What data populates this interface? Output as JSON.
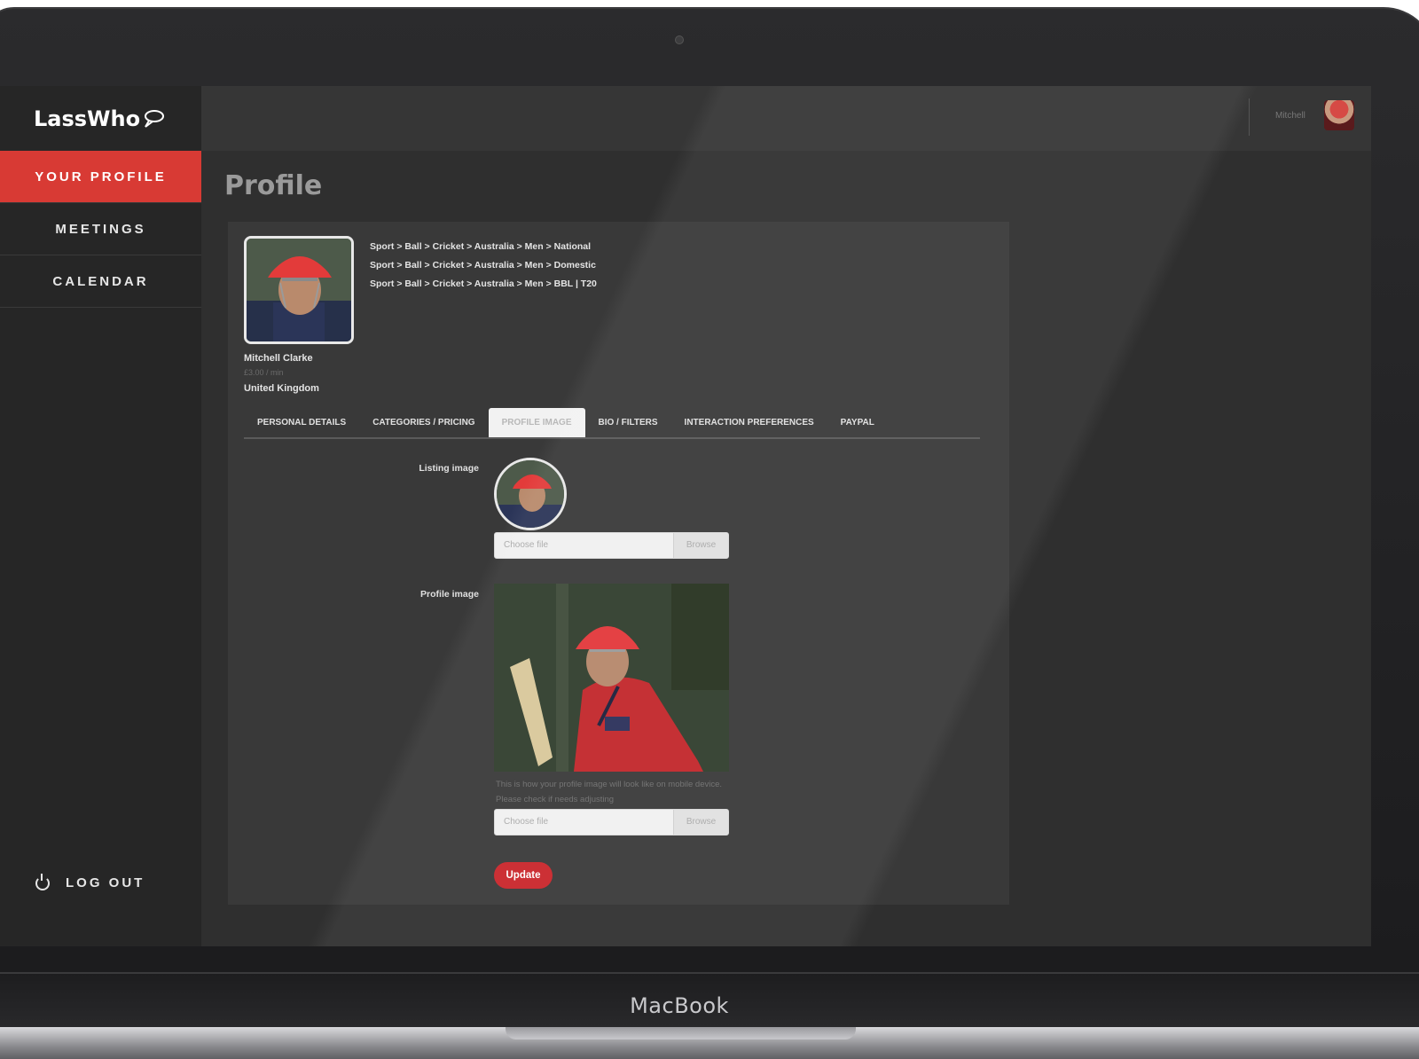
{
  "brand": {
    "name": "LassWho",
    "logo_mark_icon": "speech-bubble-icon"
  },
  "sidebar": {
    "items": [
      {
        "label": "YOUR PROFILE",
        "active": true
      },
      {
        "label": "MEETINGS",
        "active": false
      },
      {
        "label": "CALENDAR",
        "active": false
      }
    ],
    "logout_label": "LOG OUT"
  },
  "topbar": {
    "user_name": "Mitchell"
  },
  "page": {
    "title": "Profile"
  },
  "profile": {
    "name": "Mitchell Clarke",
    "rate": "£3.00 / min",
    "country": "United Kingdom",
    "categories": [
      "Sport > Ball > Cricket > Australia > Men > National",
      "Sport > Ball > Cricket > Australia > Men > Domestic",
      "Sport > Ball > Cricket > Australia > Men > BBL | T20"
    ]
  },
  "tabs": [
    {
      "label": "PERSONAL DETAILS",
      "active": false
    },
    {
      "label": "CATEGORIES / PRICING",
      "active": false
    },
    {
      "label": "PROFILE IMAGE",
      "active": true
    },
    {
      "label": "BIO / FILTERS",
      "active": false
    },
    {
      "label": "INTERACTION PREFERENCES",
      "active": false
    },
    {
      "label": "PAYPAL",
      "active": false
    }
  ],
  "form": {
    "listing_image_label": "Listing image",
    "profile_image_label": "Profile image",
    "file_placeholder": "Choose file",
    "browse_label": "Browse",
    "helper_text": "This is how your profile image will look like on mobile device. Please check if needs adjusting",
    "update_label": "Update"
  },
  "device": {
    "label": "MacBook"
  },
  "colors": {
    "accent": "#d83a34",
    "button": "#c9252a",
    "background": "#2f2f2f"
  }
}
